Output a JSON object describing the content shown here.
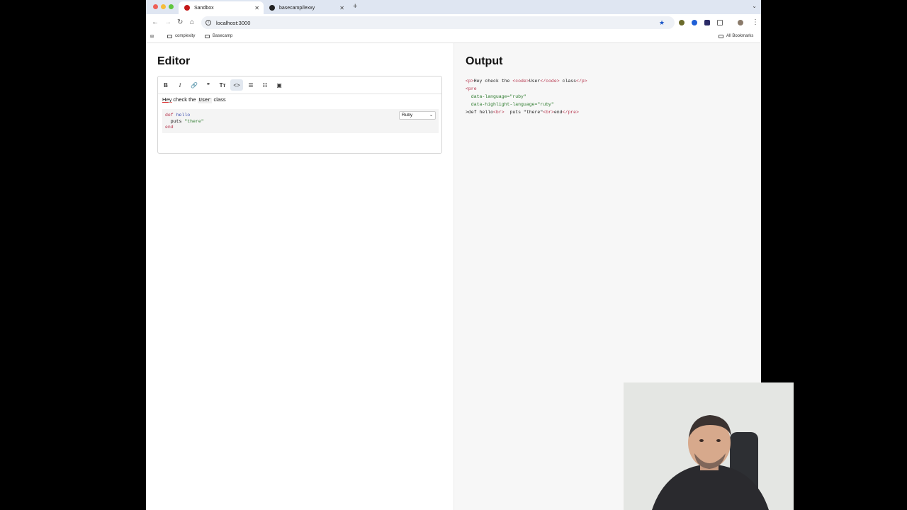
{
  "browser": {
    "tabs": [
      {
        "label": "Sandbox",
        "active": true
      },
      {
        "label": "basecamp/lexxy",
        "active": false
      }
    ],
    "url": "localhost:3000",
    "bookmarks": [
      "complexity",
      "Basecamp"
    ],
    "all_bookmarks": "All Bookmarks"
  },
  "editor": {
    "title": "Editor",
    "toolbar": [
      {
        "name": "bold",
        "glyph": "B"
      },
      {
        "name": "italic",
        "glyph": "I"
      },
      {
        "name": "link",
        "glyph": "🔗"
      },
      {
        "name": "quote",
        "glyph": "❞"
      },
      {
        "name": "heading",
        "glyph": "Tт"
      },
      {
        "name": "code",
        "glyph": "<>"
      },
      {
        "name": "bullet-list",
        "glyph": "☰"
      },
      {
        "name": "numbered-list",
        "glyph": "☷"
      },
      {
        "name": "image",
        "glyph": "▣"
      }
    ],
    "paragraph": {
      "hey": "Hey",
      "before": " check the ",
      "code": "User",
      "after": " class"
    },
    "code": {
      "l1_kw": "def",
      "l1_fn": " hello",
      "l2_indent": "  puts ",
      "l2_str": "\"there\"",
      "l3_kw": "end"
    },
    "language": "Ruby"
  },
  "output": {
    "title": "Output",
    "lines": {
      "l1a": "<p>",
      "l1b": "Hey check the ",
      "l1c": "<code>",
      "l1d": "User",
      "l1e": "</code>",
      "l1f": " class",
      "l1g": "</p>",
      "l2": "<pre",
      "l3": "  data-language=\"ruby\"",
      "l4": "  data-highlight-language=\"ruby\"",
      "l5a": ">def hello",
      "l5b": "<br>",
      "l5c": "  puts \"there\"",
      "l5d": "<br>",
      "l5e": "end",
      "l5f": "</pre>"
    }
  }
}
